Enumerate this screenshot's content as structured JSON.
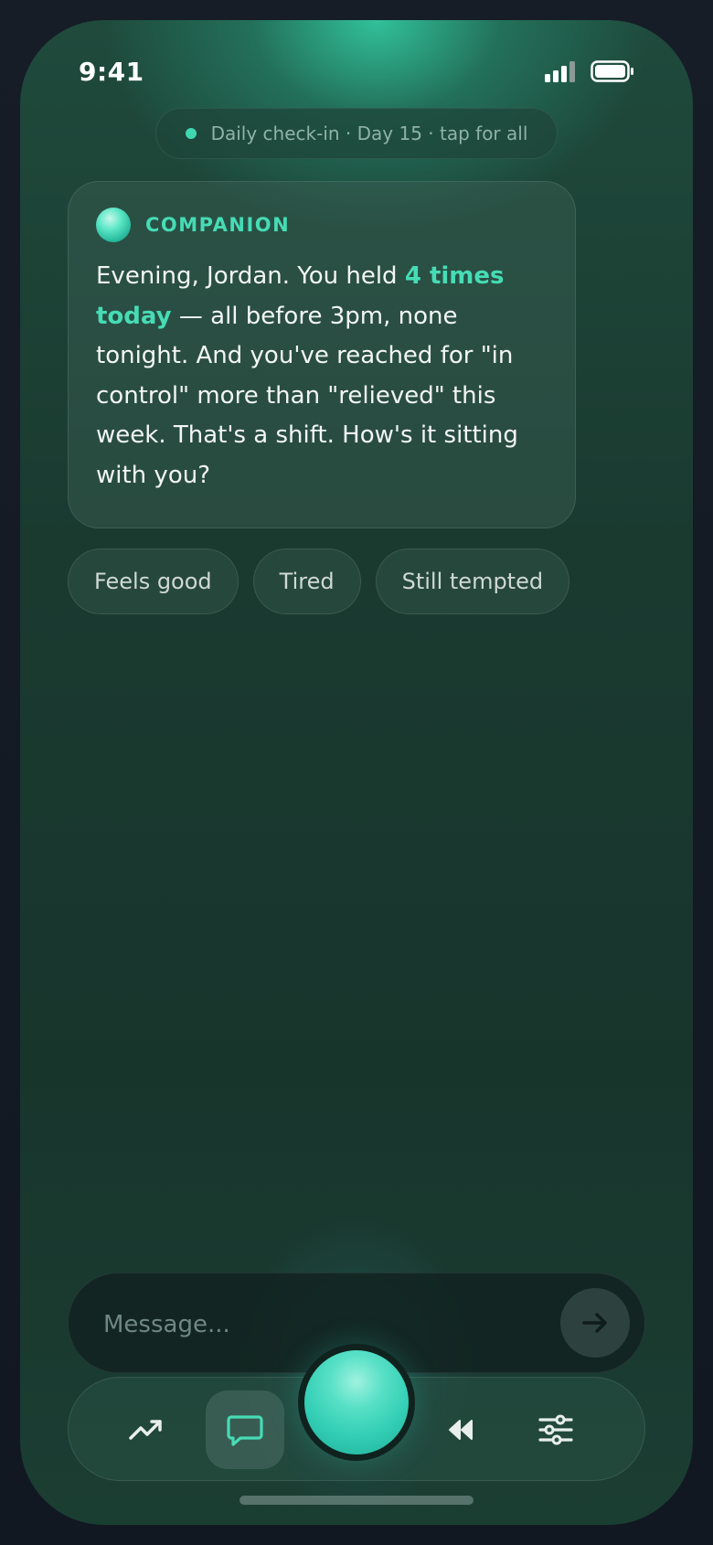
{
  "status_bar": {
    "time": "9:41"
  },
  "checkin": {
    "text": "Daily check-in · Day 15 · tap for all",
    "dot_color": "#3fd8b0"
  },
  "companion_card": {
    "label": "COMPANION",
    "message_before": "Evening, Jordan. You held ",
    "message_highlight": "4 times today",
    "message_after": " — all before 3pm, none tonight. And you've reached for \"in control\" more than \"relieved\" this week. That's a shift. How's it sitting with you?",
    "accent_color": "#46dcb5"
  },
  "quick_replies": [
    {
      "label": "Feels good"
    },
    {
      "label": "Tired"
    },
    {
      "label": "Still tempted"
    }
  ],
  "composer": {
    "placeholder": "Message...",
    "send_icon": "arrow-right-icon"
  },
  "nav": {
    "items": [
      {
        "icon": "trend-up-icon",
        "active": false
      },
      {
        "icon": "chat-bubble-icon",
        "active": true
      },
      {
        "icon": "orb-button",
        "active": false
      },
      {
        "icon": "rewind-icon",
        "active": false
      },
      {
        "icon": "sliders-icon",
        "active": false
      }
    ]
  }
}
